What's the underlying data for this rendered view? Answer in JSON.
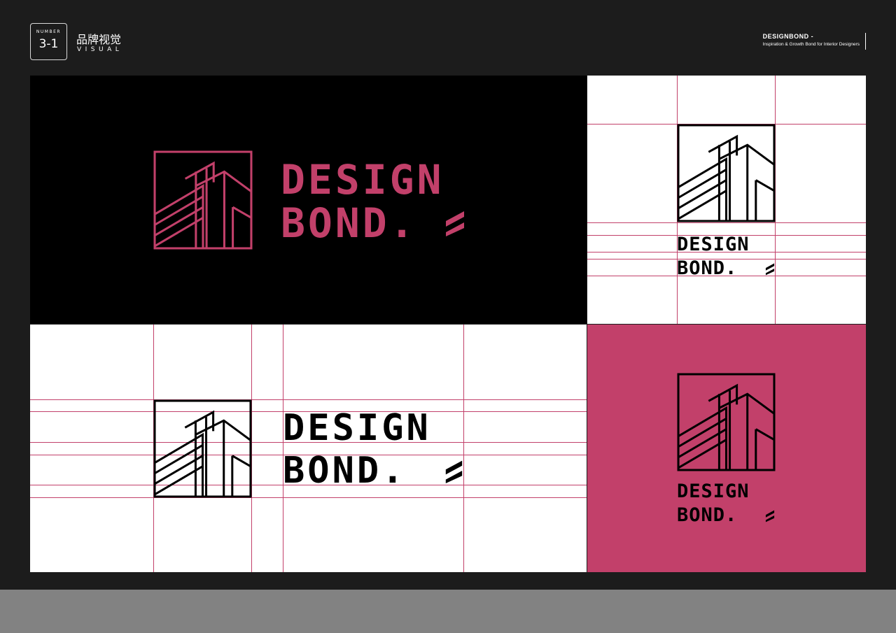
{
  "header": {
    "number_label": "NUMBER",
    "number_value": "3-1",
    "section_cn": "品牌视觉",
    "section_en": "VISUAL",
    "brand_name": "DESIGNBOND -",
    "brand_tagline": "Inspiration & Growth Bond for Interior Designers"
  },
  "logo": {
    "line1": "DESIGN",
    "line2": "BOND.",
    "mark_icon": "building-mark-icon"
  },
  "colors": {
    "board": "#1c1c1c",
    "accent": "#c2406a",
    "black": "#000000",
    "white": "#ffffff"
  }
}
